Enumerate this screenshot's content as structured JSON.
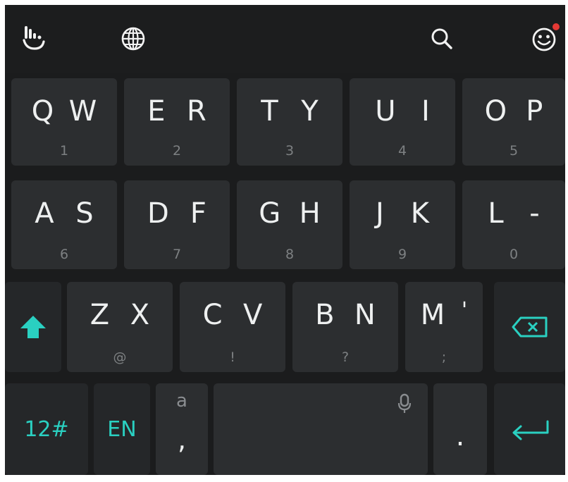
{
  "toolbar": {
    "left_icons": [
      "gesture-hand-icon",
      "globe-icon"
    ],
    "right_icons": [
      "search-icon",
      "emoji-icon"
    ]
  },
  "rows": [
    [
      {
        "a": "Q",
        "b": "W",
        "hint": "1"
      },
      {
        "a": "E",
        "b": "R",
        "hint": "2"
      },
      {
        "a": "T",
        "b": "Y",
        "hint": "3"
      },
      {
        "a": "U",
        "b": "I",
        "hint": "4"
      },
      {
        "a": "O",
        "b": "P",
        "hint": "5"
      }
    ],
    [
      {
        "a": "A",
        "b": "S",
        "hint": "6"
      },
      {
        "a": "D",
        "b": "F",
        "hint": "7"
      },
      {
        "a": "G",
        "b": "H",
        "hint": "8"
      },
      {
        "a": "J",
        "b": "K",
        "hint": "9"
      },
      {
        "a": "L",
        "b": "-",
        "hint": "0"
      }
    ],
    [
      {
        "a": "Z",
        "b": "X",
        "hint": "@"
      },
      {
        "a": "C",
        "b": "V",
        "hint": "!"
      },
      {
        "a": "B",
        "b": "N",
        "hint": "?"
      },
      {
        "a": "M",
        "b": "'",
        "hint": ";"
      }
    ]
  ],
  "bottom": {
    "numbers_label": "12#",
    "language_label": "EN",
    "comma_label": ",",
    "comma_hint": "a",
    "period_label": "."
  },
  "colors": {
    "accent": "#2ad0c1",
    "key": "#2c2e30",
    "key_dark": "#252729",
    "background": "#1b1c1d",
    "badge": "#e53935"
  }
}
